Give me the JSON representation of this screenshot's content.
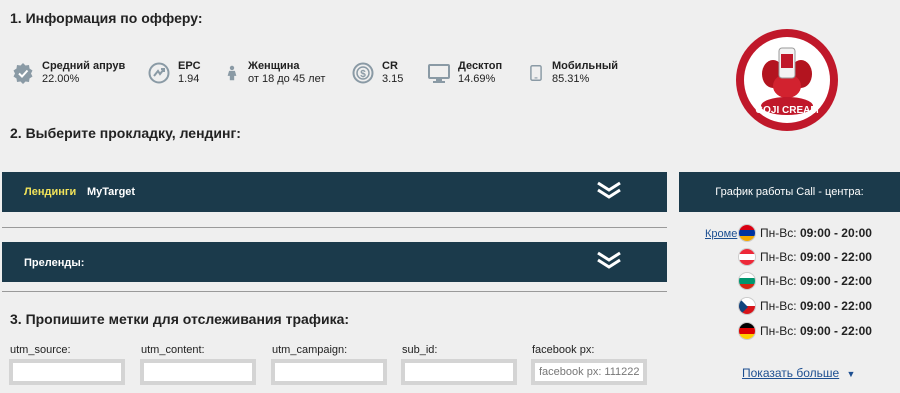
{
  "section1": {
    "title": "1. Информация по офферу:"
  },
  "stats": [
    {
      "label": "Средний апрув",
      "value": "22.00%",
      "icon": "approve-badge-icon"
    },
    {
      "label": "EPC",
      "value": "1.94",
      "icon": "epc-icon"
    },
    {
      "label": "Женщина",
      "value": "от 18 до 45 лет",
      "icon": "woman-icon"
    },
    {
      "label": "CR",
      "value": "3.15",
      "icon": "cr-icon"
    },
    {
      "label": "Десктоп",
      "value": "14.69%",
      "icon": "desktop-icon"
    },
    {
      "label": "Мобильный",
      "value": "85.31%",
      "icon": "mobile-icon"
    }
  ],
  "logo": {
    "text": "GOJI CREAM",
    "brand_color": "#c0182a"
  },
  "section2": {
    "title": "2. Выберите прокладку, лендинг:"
  },
  "landings_bar": {
    "label": "Лендинги",
    "value": "MyTarget"
  },
  "prelands_bar": {
    "label": "Преленды:"
  },
  "section3": {
    "title": "3. Пропишите метки для отслеживания трафика:"
  },
  "tracking_fields": [
    {
      "label": "utm_source:",
      "value": ""
    },
    {
      "label": "utm_content:",
      "value": ""
    },
    {
      "label": "utm_campaign:",
      "value": ""
    },
    {
      "label": "sub_id:",
      "value": ""
    },
    {
      "label": "facebook px:",
      "value": "",
      "placeholder": "facebook px: 11122233"
    }
  ],
  "call_center": {
    "title": "График работы Call - центра:",
    "link": "Кроме",
    "schedule": [
      {
        "country": "armenia",
        "days": "Пн-Вс:",
        "hours": "09:00 - 20:00"
      },
      {
        "country": "austria",
        "days": "Пн-Вс:",
        "hours": "09:00 - 22:00"
      },
      {
        "country": "bulgaria",
        "days": "Пн-Вс:",
        "hours": "09:00 - 22:00"
      },
      {
        "country": "czech",
        "days": "Пн-Вс:",
        "hours": "09:00 - 22:00"
      },
      {
        "country": "germany",
        "days": "Пн-Вс:",
        "hours": "09:00 - 22:00"
      }
    ],
    "show_more": "Показать больше"
  },
  "colors": {
    "bar": "#1b3a4b",
    "accent_yellow": "#f2e35a",
    "link": "#1d4f91",
    "icon": "#8a9aa5"
  }
}
